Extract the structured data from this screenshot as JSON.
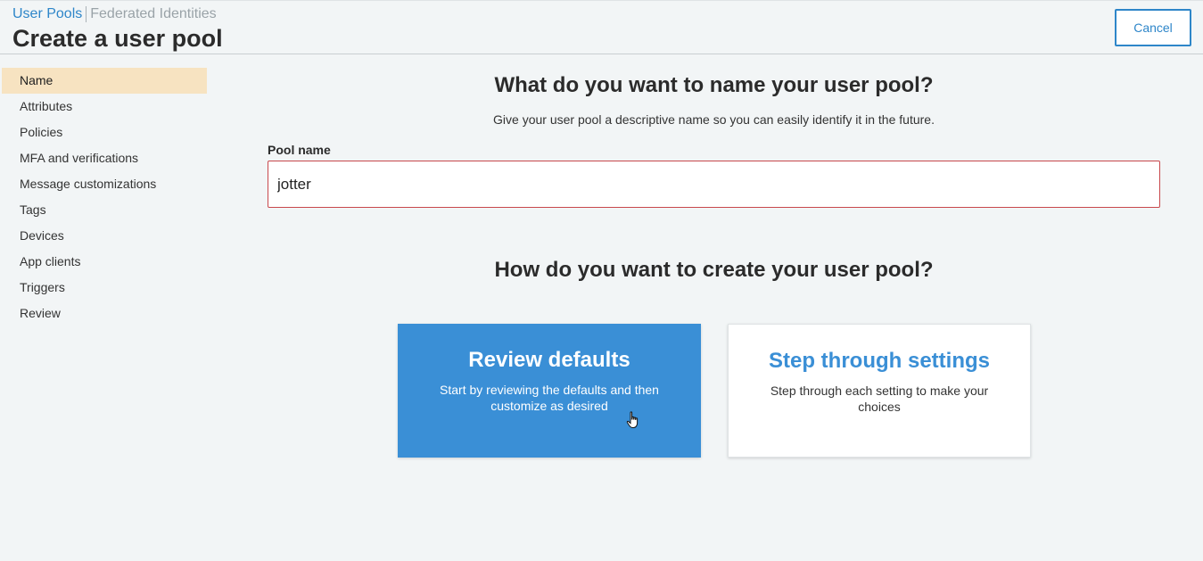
{
  "header": {
    "breadcrumb_active": "User Pools",
    "breadcrumb_inactive": "Federated Identities",
    "title": "Create a user pool",
    "cancel_label": "Cancel"
  },
  "sidebar": {
    "items": [
      {
        "label": "Name",
        "active": true
      },
      {
        "label": "Attributes"
      },
      {
        "label": "Policies"
      },
      {
        "label": "MFA and verifications"
      },
      {
        "label": "Message customizations"
      },
      {
        "label": "Tags"
      },
      {
        "label": "Devices"
      },
      {
        "label": "App clients"
      },
      {
        "label": "Triggers"
      },
      {
        "label": "Review"
      }
    ]
  },
  "main": {
    "name_question": "What do you want to name your user pool?",
    "name_description": "Give your user pool a descriptive name so you can easily identify it in the future.",
    "pool_name_label": "Pool name",
    "pool_name_value": "jotter",
    "create_question": "How do you want to create your user pool?",
    "options": [
      {
        "title": "Review defaults",
        "description": "Start by reviewing the defaults and then customize as desired"
      },
      {
        "title": "Step through settings",
        "description": "Step through each setting to make your choices"
      }
    ]
  },
  "colors": {
    "accent": "#2e86c9",
    "card_primary": "#3a8fd6",
    "active_nav": "#f7e3c1",
    "input_error_border": "#c8484c"
  },
  "icons": {
    "cursor": "hand-pointer-icon"
  }
}
